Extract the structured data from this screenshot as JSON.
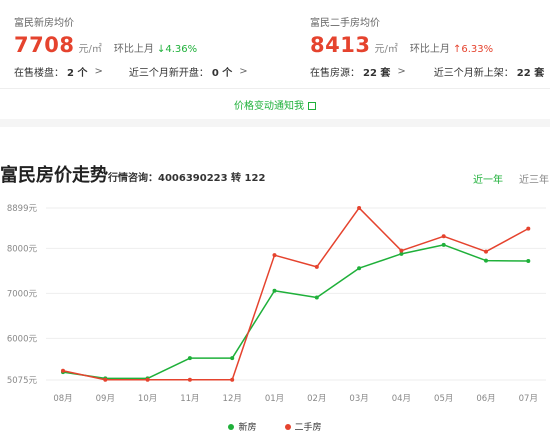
{
  "new_house": {
    "title": "富民新房均价",
    "price": "7708",
    "unit": "元/㎡",
    "change_label": "环比上月",
    "change_value": "↓4.36%",
    "on_sale_label": "在售楼盘：",
    "on_sale_value": "2 个",
    "new_open_label": "近三个月新开盘：",
    "new_open_value": "0 个"
  },
  "second_hand": {
    "title": "富民二手房均价",
    "price": "8413",
    "unit": "元/㎡",
    "change_label": "环比上月",
    "change_value": "↑6.33%",
    "on_sale_label": "在售房源：",
    "on_sale_value": "22 套",
    "new_list_label": "近三个月新上架：",
    "new_list_value": "22 套"
  },
  "notify": {
    "label": "价格变动通知我"
  },
  "trend": {
    "title": "富民房价走势",
    "hotline": "行情咨询：4006390223 转 122",
    "tab_1y": "近一年",
    "tab_3y": "近三年"
  },
  "colors": {
    "new_house": "#1fb03a",
    "second_hand": "#e5432e",
    "accent": "#1fb03a"
  },
  "chart_data": {
    "type": "line",
    "categories": [
      "08月",
      "09月",
      "10月",
      "11月",
      "12月",
      "01月",
      "02月",
      "03月",
      "04月",
      "05月",
      "06月",
      "07月"
    ],
    "y_ticks": [
      {
        "value": 5075,
        "label": "5075元"
      },
      {
        "value": 6000,
        "label": "6000元"
      },
      {
        "value": 7000,
        "label": "7000元"
      },
      {
        "value": 8000,
        "label": "8000元"
      },
      {
        "value": 8899,
        "label": "8899元"
      }
    ],
    "ylim": [
      5075,
      8899
    ],
    "grid": true,
    "legend_position": "bottom-center",
    "series": [
      {
        "name": "新房",
        "color": "#1fb03a",
        "values": [
          5250,
          5110,
          5110,
          5560,
          5560,
          7060,
          6910,
          7560,
          7880,
          8080,
          7730,
          7720
        ]
      },
      {
        "name": "二手房",
        "color": "#e5432e",
        "values": [
          5280,
          5080,
          5080,
          5080,
          5080,
          7850,
          7590,
          8900,
          7950,
          8270,
          7930,
          8440
        ]
      }
    ]
  }
}
